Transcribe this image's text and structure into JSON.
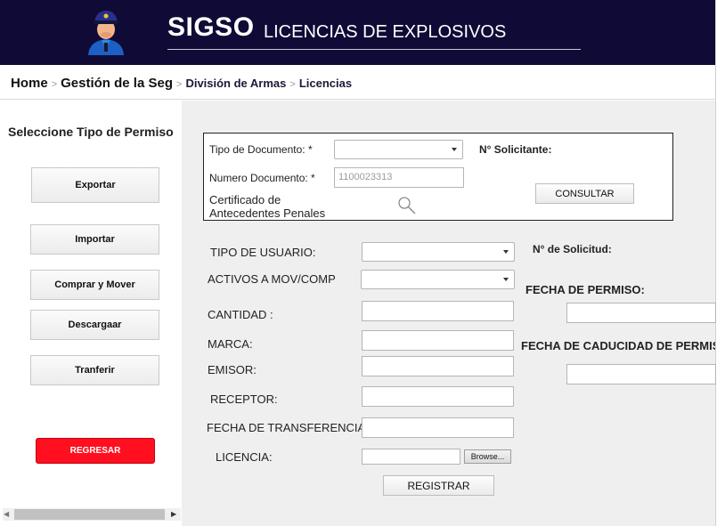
{
  "header": {
    "title": "SIGSO",
    "subtitle": "LICENCIAS DE EXPLOSIVOS",
    "logo": "police-officer-logo"
  },
  "breadcrumb": {
    "items": [
      "Home",
      "Gestión de la Seg",
      "División de Armas",
      "Licencias"
    ],
    "separator": ">"
  },
  "sidebar": {
    "title": "Seleccione Tipo de Permiso",
    "buttons": [
      "Exportar",
      "Importar",
      "Comprar y Mover",
      "Descargaar",
      "Tranferir"
    ],
    "back_button": "REGRESAR"
  },
  "lookup": {
    "doc_type_label": "Tipo de Documento: *",
    "doc_type_value": "",
    "solicitante_label": "N° Solicitante:",
    "doc_number_label": "Numero Documento: *",
    "doc_number_value": "1100023313",
    "certificate_label_line1": "Certificado de",
    "certificate_label_line2": "Antecedentes Penales",
    "search_icon": "magnifier",
    "consult_button": "CONSULTAR"
  },
  "form": {
    "tipo_usuario_label": "TIPO DE  USUARIO:",
    "activos_label": "ACTIVOS A MOV/COMP",
    "cantidad_label": "CANTIDAD :",
    "marca_label": "MARCA:",
    "emisor_label": "EMISOR:",
    "receptor_label": "RECEPTOR:",
    "fecha_transferencia_label": "FECHA DE TRANSFERENCIA",
    "licencia_label": "LICENCIA:",
    "browse_button": "Browse...",
    "register_button": "REGISTRAR",
    "solicitud_label": "N° de Solicitud:",
    "fecha_permiso_label": "FECHA DE PERMISO:",
    "fecha_caducidad_label": "FECHA DE CADUCIDAD DE PERMISO"
  },
  "colors": {
    "header_bg": "#0f0b36",
    "back_button": "#ff0f1f",
    "panel_bg": "#efefef"
  }
}
